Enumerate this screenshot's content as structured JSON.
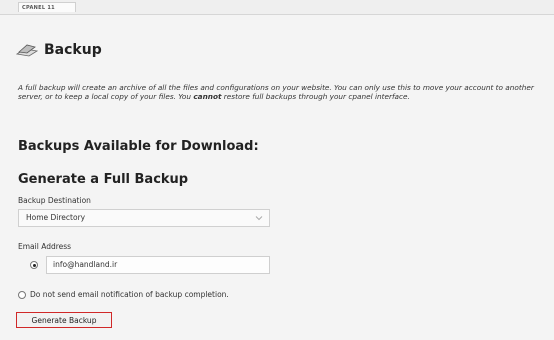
{
  "top_tab": "CPANEL 11",
  "page_title": "Backup",
  "description": {
    "part1": "A full backup will create an archive of all the files and configurations on your website. You can only use this to move your account to another server, or to keep a local copy of your files. You ",
    "emphasis": "cannot",
    "part2": " restore full backups through your cpanel interface."
  },
  "available_heading": "Backups Available for Download:",
  "generate_heading": "Generate a Full Backup",
  "destination": {
    "label": "Backup Destination",
    "selected": "Home Directory"
  },
  "email": {
    "label": "Email Address",
    "value": "info@handland.ir",
    "no_notify_label": "Do not send email notification of backup completion."
  },
  "generate_button": "Generate Backup",
  "colors": {
    "button_border": "#d02828",
    "background": "#f4f4f4"
  },
  "icons": {
    "title_icon": "backup-icon",
    "select_arrow": "chevron-down-icon"
  }
}
